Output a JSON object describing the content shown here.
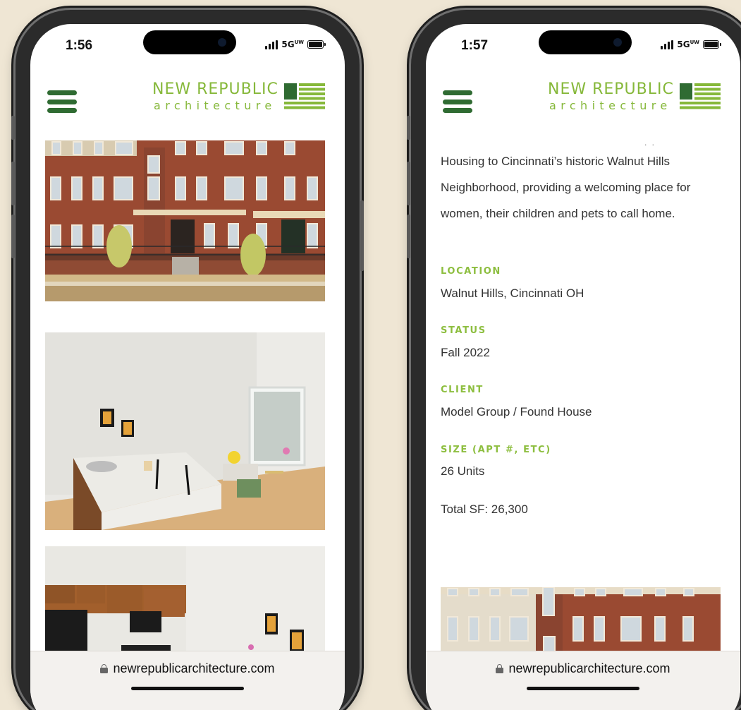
{
  "colors": {
    "background": "#efe6d4",
    "brand_green": "#86b83a",
    "brand_dark_green": "#2f6b32",
    "label_green": "#8dbe3f"
  },
  "brand": {
    "name_top": "NEW REPUBLIC",
    "name_bottom": "architecture",
    "logo_icon": "striped-flag-icon"
  },
  "browser": {
    "url": "newrepublicarchitecture.com",
    "lock_icon": "lock-icon"
  },
  "phones": [
    {
      "status": {
        "time": "1:56",
        "network": "5GᵁᵂW"
      },
      "photos": [
        {
          "subject": "brick apartment building exterior"
        },
        {
          "subject": "kitchen island and living area"
        },
        {
          "subject": "kitchen with wood cabinets"
        }
      ]
    },
    {
      "status": {
        "time": "1:57",
        "network": "5GᵁᵂW"
      },
      "description_lines": [
        "Housing to Cincinnati’s historic Walnut Hills",
        "Neighborhood, providing a welcoming place for",
        "women, their children and pets to call home."
      ],
      "details": {
        "location_label": "LOCATION",
        "location_value": "Walnut Hills, Cincinnati OH",
        "status_label": "STATUS",
        "status_value": "Fall 2022",
        "client_label": "CLIENT",
        "client_value": "Model Group / Found House",
        "size_label": "SIZE (APT #, ETC)",
        "size_value": "26 Units",
        "total_sf": "Total SF: 26,300"
      }
    }
  ]
}
